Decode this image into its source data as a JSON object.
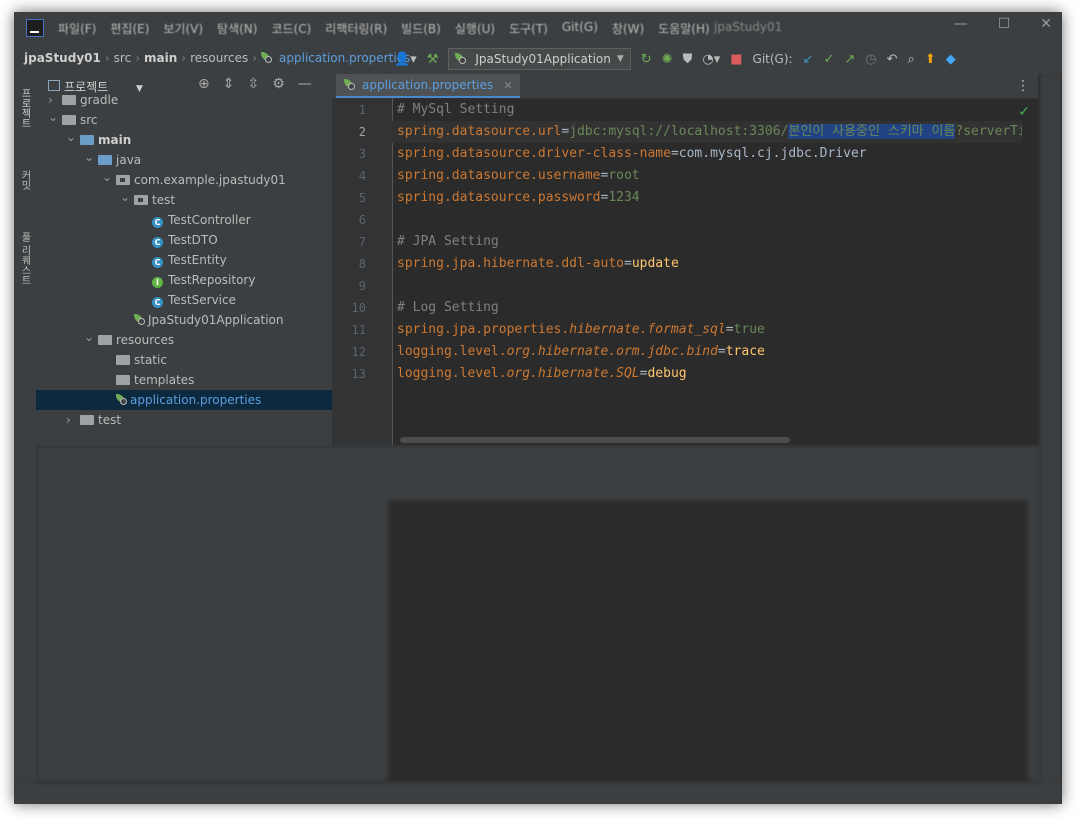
{
  "menu": [
    "파일(F)",
    "편집(E)",
    "보기(V)",
    "탐색(N)",
    "코드(C)",
    "리팩터링(R)",
    "빌드(B)",
    "실행(U)",
    "도구(T)",
    "Git(G)",
    "창(W)",
    "도움말(H)"
  ],
  "window_title": "jpaStudy01",
  "breadcrumbs": {
    "project": "jpaStudy01",
    "src": "src",
    "main": "main",
    "resources": "resources",
    "file": "application.properties"
  },
  "toolbar": {
    "run_config": "JpaStudy01Application",
    "git_label": "Git(G):"
  },
  "side_tabs": {
    "project": "프로젝트",
    "commit": "커밋",
    "pull_requests": "풀 리퀘스트"
  },
  "project_panel": {
    "title": "프로젝트",
    "tree": [
      {
        "label": "gradle",
        "depth": 1,
        "kind": "folder",
        "arrow": "›"
      },
      {
        "label": "src",
        "depth": 1,
        "kind": "folder",
        "arrow": "⌄"
      },
      {
        "label": "main",
        "depth": 2,
        "kind": "folder-src",
        "arrow": "⌄",
        "bold": true
      },
      {
        "label": "java",
        "depth": 3,
        "kind": "folder-blue",
        "arrow": "⌄"
      },
      {
        "label": "com.example.jpastudy01",
        "depth": 4,
        "kind": "package",
        "arrow": "⌄"
      },
      {
        "label": "test",
        "depth": 5,
        "kind": "package",
        "arrow": "⌄"
      },
      {
        "label": "TestController",
        "depth": 6,
        "kind": "class"
      },
      {
        "label": "TestDTO",
        "depth": 6,
        "kind": "class"
      },
      {
        "label": "TestEntity",
        "depth": 6,
        "kind": "class"
      },
      {
        "label": "TestRepository",
        "depth": 6,
        "kind": "interface"
      },
      {
        "label": "TestService",
        "depth": 6,
        "kind": "class"
      },
      {
        "label": "JpaStudy01Application",
        "depth": 5,
        "kind": "spring"
      },
      {
        "label": "resources",
        "depth": 3,
        "kind": "folder-res",
        "arrow": "⌄"
      },
      {
        "label": "static",
        "depth": 4,
        "kind": "folder"
      },
      {
        "label": "templates",
        "depth": 4,
        "kind": "folder"
      },
      {
        "label": "application.properties",
        "depth": 4,
        "kind": "props",
        "selected": true
      },
      {
        "label": "test",
        "depth": 2,
        "kind": "folder",
        "arrow": "›"
      }
    ]
  },
  "editor": {
    "tab_label": "application.properties",
    "lines": [
      [
        {
          "t": "# MySql Setting",
          "c": "cmt"
        }
      ],
      [
        {
          "t": "spring.datasource.url",
          "c": "key"
        },
        {
          "t": "=",
          "c": "plain"
        },
        {
          "t": "jdbc:mysql://localhost:3306/",
          "c": "val"
        },
        {
          "t": "본인이 사용중인 스키마 이름",
          "c": "val hl"
        },
        {
          "t": "?serverTimezone=UTC",
          "c": "val"
        }
      ],
      [
        {
          "t": "spring.datasource.driver-class-name",
          "c": "key"
        },
        {
          "t": "=",
          "c": "plain"
        },
        {
          "t": "com.mysql.cj.jdbc.Driver",
          "c": "plain"
        }
      ],
      [
        {
          "t": "spring.datasource.username",
          "c": "key"
        },
        {
          "t": "=",
          "c": "plain"
        },
        {
          "t": "root",
          "c": "val"
        }
      ],
      [
        {
          "t": "spring.datasource.password",
          "c": "key"
        },
        {
          "t": "=",
          "c": "plain"
        },
        {
          "t": "1234",
          "c": "val"
        }
      ],
      [],
      [
        {
          "t": "# JPA Setting",
          "c": "cmt"
        }
      ],
      [
        {
          "t": "spring.jpa.hibernate.ddl-auto",
          "c": "key"
        },
        {
          "t": "=",
          "c": "plain"
        },
        {
          "t": "update",
          "c": "strong"
        }
      ],
      [],
      [
        {
          "t": "# Log Setting",
          "c": "cmt"
        }
      ],
      [
        {
          "t": "spring.jpa.properties.",
          "c": "key"
        },
        {
          "t": "hibernate.format_sql",
          "c": "key ital"
        },
        {
          "t": "=",
          "c": "plain"
        },
        {
          "t": "true",
          "c": "val"
        }
      ],
      [
        {
          "t": "logging.level.",
          "c": "key"
        },
        {
          "t": "org.hibernate.orm.jdbc.bind",
          "c": "key ital"
        },
        {
          "t": "=",
          "c": "plain"
        },
        {
          "t": "trace",
          "c": "strong"
        }
      ],
      [
        {
          "t": "logging.level.",
          "c": "key"
        },
        {
          "t": "org.hibernate.SQL",
          "c": "key ital"
        },
        {
          "t": "=",
          "c": "plain"
        },
        {
          "t": "debug",
          "c": "strong"
        }
      ]
    ],
    "current_line": 2
  }
}
